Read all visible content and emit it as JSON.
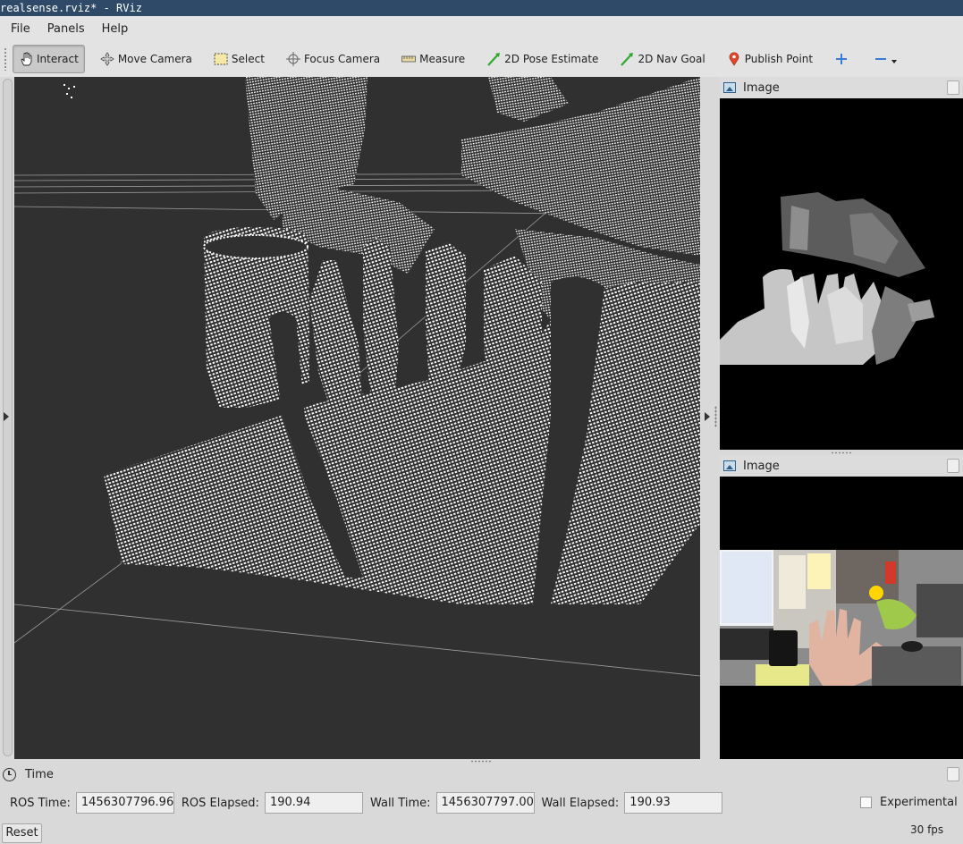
{
  "window": {
    "title": "realsense.rviz* - RViz"
  },
  "menu": [
    {
      "label": "File"
    },
    {
      "label": "Panels"
    },
    {
      "label": "Help"
    }
  ],
  "toolbar": {
    "interact": "Interact",
    "move_camera": "Move Camera",
    "select": "Select",
    "focus_camera": "Focus Camera",
    "measure": "Measure",
    "pose_estimate": "2D Pose Estimate",
    "nav_goal": "2D Nav Goal",
    "publish_point": "Publish Point"
  },
  "panels": {
    "depth_image": {
      "title": "Image"
    },
    "color_image": {
      "title": "Image"
    }
  },
  "time": {
    "title": "Time",
    "ros_time_label": "ROS Time:",
    "ros_time": "1456307796.96",
    "ros_elapsed_label": "ROS Elapsed:",
    "ros_elapsed": "190.94",
    "wall_time_label": "Wall Time:",
    "wall_time": "1456307797.00",
    "wall_elapsed_label": "Wall Elapsed:",
    "wall_elapsed": "190.93",
    "experimental_label": "Experimental",
    "experimental_checked": false,
    "reset_label": "Reset",
    "fps": "30 fps"
  },
  "colors": {
    "titlebar": "#2f4a68",
    "viewport_bg": "#303030",
    "pointcloud": "#ffffff",
    "chrome": "#d9d9d9"
  }
}
